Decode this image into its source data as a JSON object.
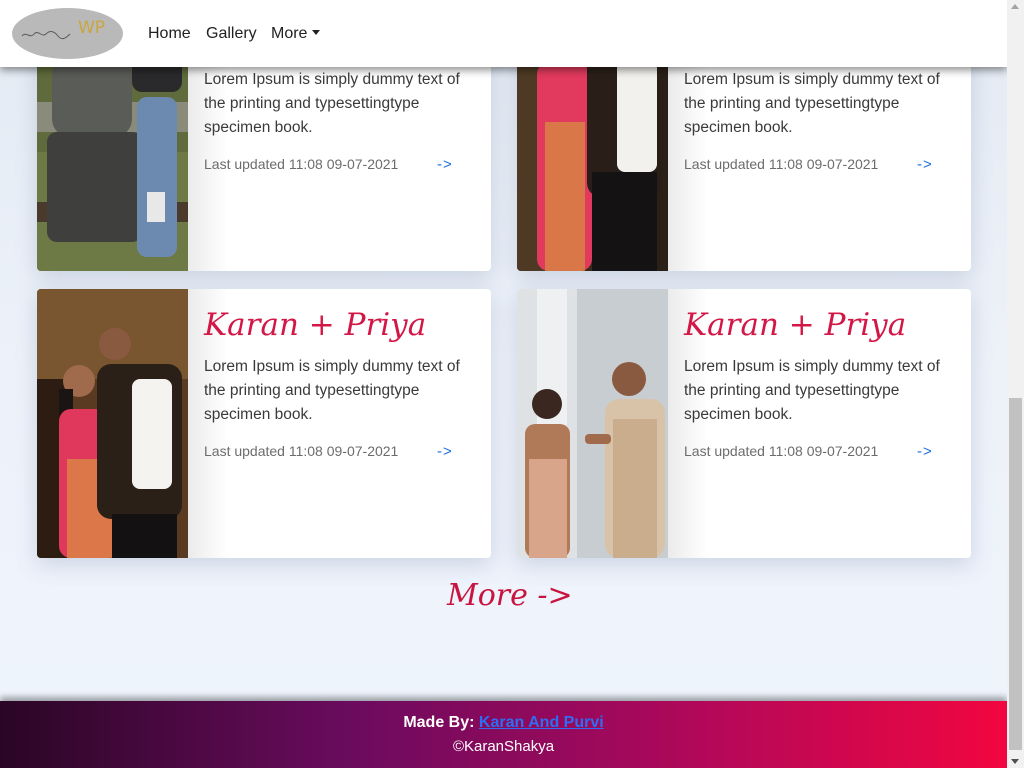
{
  "navbar": {
    "logo_text": "WP",
    "links": [
      "Home",
      "Gallery",
      "More"
    ]
  },
  "cards": [
    {
      "title": "",
      "text": "Lorem Ipsum is simply dummy text of the printing and typesettingtype specimen book.",
      "meta": "Last updated 11:08 09-07-2021",
      "arrow": "->",
      "image": "couple-photo-park-bench"
    },
    {
      "title": "",
      "text": "Lorem Ipsum is simply dummy text of the printing and typesettingtype specimen book.",
      "meta": "Last updated 11:08 09-07-2021",
      "arrow": "->",
      "image": "couple-photo-traditional"
    },
    {
      "title": "Karan + Priya",
      "text": "Lorem Ipsum is simply dummy text of the printing and typesettingtype specimen book.",
      "meta": "Last updated 11:08 09-07-2021",
      "arrow": "->",
      "image": "couple-photo-traditional"
    },
    {
      "title": "Karan + Priya",
      "text": "Lorem Ipsum is simply dummy text of the printing and typesettingtype specimen book.",
      "meta": "Last updated 11:08 09-07-2021",
      "arrow": "->",
      "image": "couple-photo-outdoor"
    }
  ],
  "more_link": "More ->",
  "footer": {
    "made_by_label": "Made By:",
    "made_by_link": "Karan And Purvi",
    "copyright": "©KaranShakya"
  },
  "colors": {
    "accent_title": "#d31747",
    "link_blue": "#1a6fe0",
    "footer_gradient_start": "#2a0625",
    "footer_gradient_end": "#f2063f"
  }
}
